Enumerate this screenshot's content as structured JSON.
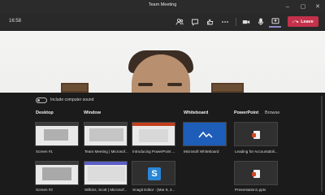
{
  "window": {
    "title": "Team Meeting"
  },
  "toolbar": {
    "timer": "16:58",
    "leave_label": "Leave"
  },
  "share_panel": {
    "include_sound_label": "Include computer sound",
    "sections": {
      "desktop": "Desktop",
      "window": "Window",
      "whiteboard": "Whiteboard",
      "powerpoint": "PowerPoint",
      "browse": "Browse"
    },
    "desktop_items": [
      "Screen #1",
      "Screen #2"
    ],
    "window_items": [
      "Team Meeting | Microsof...",
      "Introducing PowerPoint ...",
      "Wilkins, Scott | Microsof...",
      "Snagit Editor - [Mar 8, 2..."
    ],
    "whiteboard_items": [
      "Microsoft Whiteboard"
    ],
    "powerpoint_items": [
      "Leading for Accountabili...",
      "Presentation1.pptx"
    ]
  },
  "icons": [
    "participants-icon",
    "chat-icon",
    "reactions-icon",
    "more-icon",
    "camera-icon",
    "mic-icon",
    "share-icon",
    "phone-icon"
  ],
  "colors": {
    "leave": "#c4314b",
    "accent": "#8b8cc7",
    "whiteboard": "#1e5db8"
  }
}
